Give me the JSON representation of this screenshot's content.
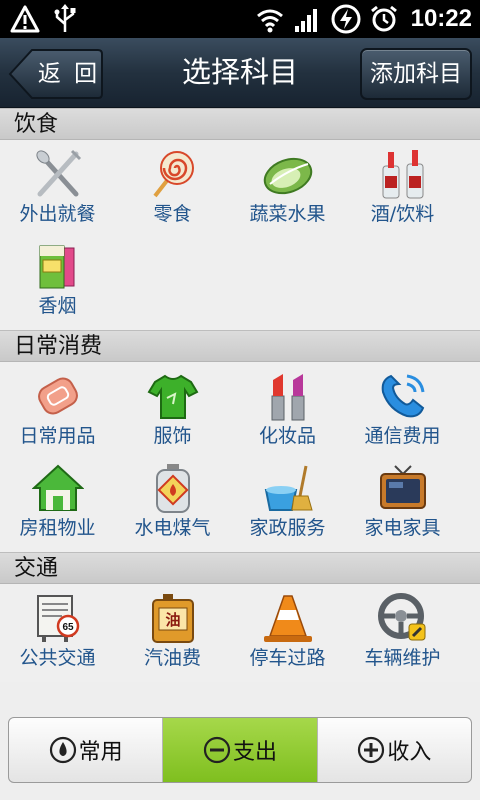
{
  "status_bar": {
    "time": "10:22",
    "icons": [
      "warning-icon",
      "usb-icon",
      "wifi-icon",
      "signal-icon",
      "sync-icon",
      "alarm-icon"
    ]
  },
  "header": {
    "back_label": "返 回",
    "title": "选择科目",
    "add_label": "添加科目"
  },
  "sections": [
    {
      "title": "饮食",
      "items": [
        {
          "label": "外出就餐",
          "icon": "fork-knife-icon"
        },
        {
          "label": "零食",
          "icon": "lollipop-icon"
        },
        {
          "label": "蔬菜水果",
          "icon": "cabbage-icon"
        },
        {
          "label": "酒/饮料",
          "icon": "bottles-icon"
        },
        {
          "label": "香烟",
          "icon": "cigarettes-icon"
        }
      ]
    },
    {
      "title": "日常消费",
      "items": [
        {
          "label": "日常用品",
          "icon": "soap-icon"
        },
        {
          "label": "服饰",
          "icon": "tshirt-icon"
        },
        {
          "label": "化妆品",
          "icon": "lipstick-icon"
        },
        {
          "label": "通信费用",
          "icon": "phone-icon"
        },
        {
          "label": "房租物业",
          "icon": "house-icon"
        },
        {
          "label": "水电煤气",
          "icon": "gas-tank-icon"
        },
        {
          "label": "家政服务",
          "icon": "cleaning-icon"
        },
        {
          "label": "家电家具",
          "icon": "tv-icon"
        }
      ]
    },
    {
      "title": "交通",
      "items": [
        {
          "label": "公共交通",
          "icon": "bus-stop-icon",
          "sign_text": "65"
        },
        {
          "label": "汽油费",
          "icon": "jerrycan-icon",
          "sign_text": "油"
        },
        {
          "label": "停车过路",
          "icon": "traffic-cone-icon"
        },
        {
          "label": "车辆维护",
          "icon": "steering-wheel-icon"
        }
      ]
    }
  ],
  "tabs": [
    {
      "label": "常用",
      "icon": "drop-icon",
      "active": false
    },
    {
      "label": "支出",
      "icon": "minus-circle-icon",
      "active": true
    },
    {
      "label": "收入",
      "icon": "plus-circle-icon",
      "active": false
    }
  ],
  "colors": {
    "titlebar": "#23313f",
    "label_text": "#22558c",
    "active_tab": "#8fc832",
    "section_header": "#d2d2d2"
  }
}
